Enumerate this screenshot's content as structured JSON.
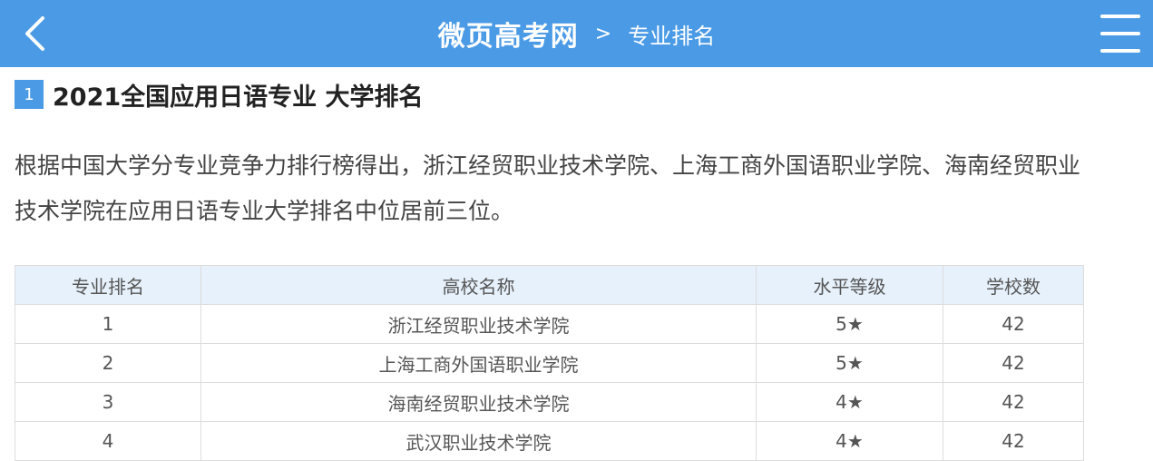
{
  "header": {
    "site_name": "微页高考网",
    "separator": ">",
    "page_name": "专业排名"
  },
  "section": {
    "number": "1",
    "title": "2021全国应用日语专业 大学排名"
  },
  "description": "根据中国大学分专业竞争力排行榜得出，浙江经贸职业技术学院、上海工商外国语职业学院、海南经贸职业技术学院在应用日语专业大学排名中位居前三位。",
  "table": {
    "headers": [
      "专业排名",
      "高校名称",
      "水平等级",
      "学校数"
    ],
    "rows": [
      [
        "1",
        "浙江经贸职业技术学院",
        "5★",
        "42"
      ],
      [
        "2",
        "上海工商外国语职业学院",
        "5★",
        "42"
      ],
      [
        "3",
        "海南经贸职业技术学院",
        "4★",
        "42"
      ],
      [
        "4",
        "武汉职业技术学院",
        "4★",
        "42"
      ]
    ]
  },
  "colors": {
    "header_bg": "#4a9ae6",
    "table_header_bg": "#e7f1fb"
  }
}
